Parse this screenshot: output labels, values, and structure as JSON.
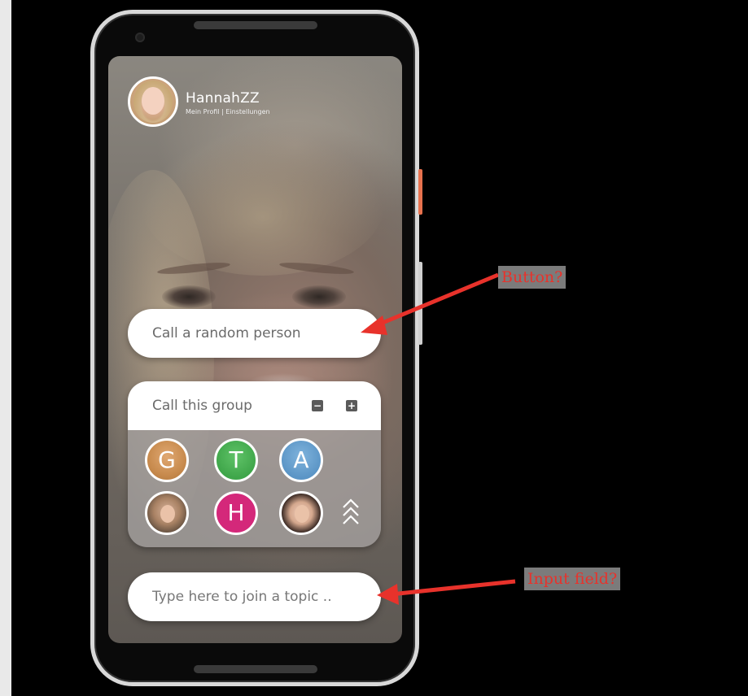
{
  "profile": {
    "name": "HannahZZ",
    "links": "Mein Profil | Einstellungen"
  },
  "random_call": {
    "label": "Call a random person"
  },
  "group": {
    "title": "Call this group",
    "minus": "−",
    "plus": "+",
    "members": [
      {
        "initial": "G",
        "color": "#c88b4e"
      },
      {
        "initial": "T",
        "color": "#3fa64a"
      },
      {
        "initial": "A",
        "color": "#5b95c6"
      },
      {
        "initial": "",
        "type": "photo"
      },
      {
        "initial": "H",
        "color": "#d4287a"
      },
      {
        "initial": "",
        "type": "photo"
      }
    ]
  },
  "topic": {
    "placeholder": "Type here to join a topic .."
  },
  "annotations": {
    "button": "Button?",
    "input": "Input field?",
    "arrow_color": "#e8322b"
  },
  "icons": [
    "camera-icon",
    "minus-icon",
    "plus-icon",
    "chevrons-up-icon",
    "arrow-icon"
  ]
}
